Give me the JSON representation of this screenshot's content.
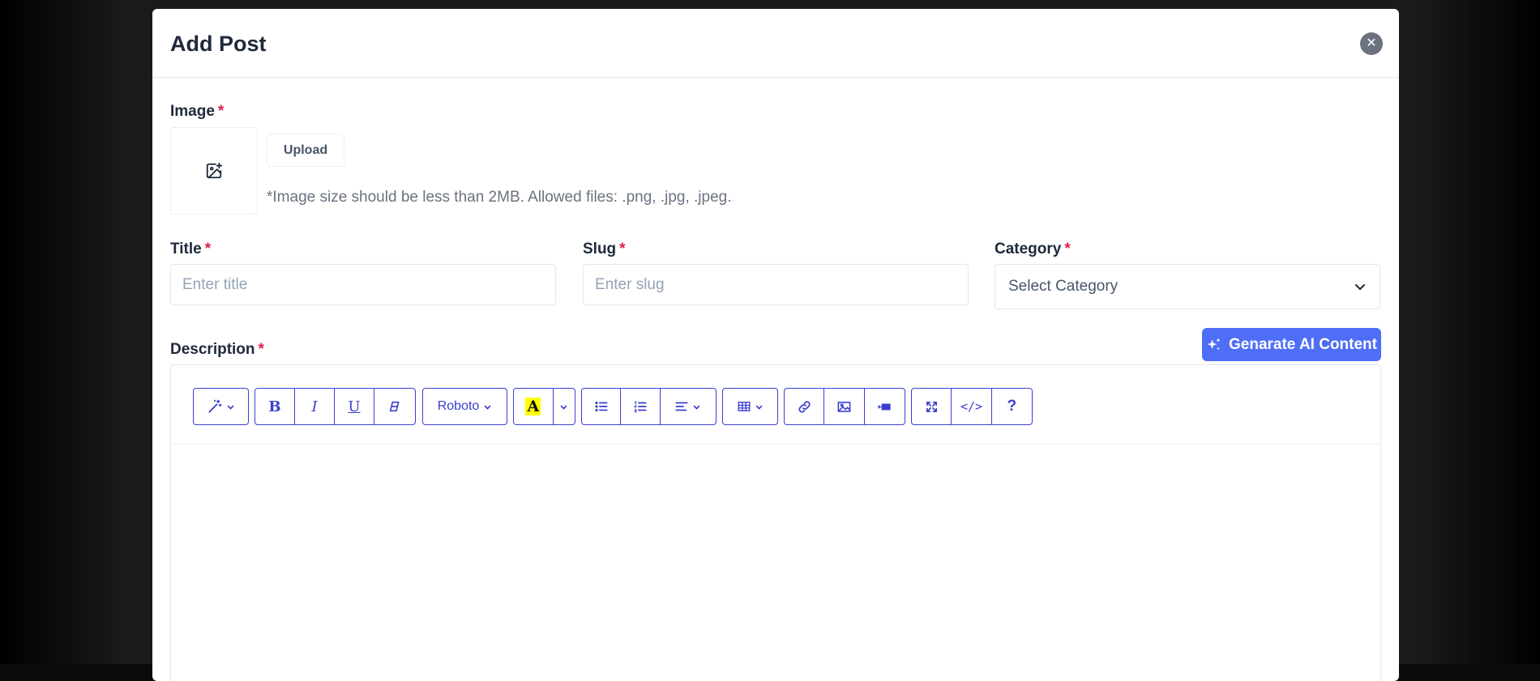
{
  "modal": {
    "title": "Add Post",
    "close_symbol": "✕"
  },
  "image_field": {
    "label": "Image",
    "required_mark": "*",
    "upload_label": "Upload",
    "hint": "*Image size should be less than 2MB. Allowed files: .png, .jpg, .jpeg."
  },
  "title_field": {
    "label": "Title",
    "required_mark": "*",
    "placeholder": "Enter title",
    "value": ""
  },
  "slug_field": {
    "label": "Slug",
    "required_mark": "*",
    "placeholder": "Enter slug",
    "value": ""
  },
  "category_field": {
    "label": "Category",
    "required_mark": "*",
    "selected": "Select Category"
  },
  "description_field": {
    "label": "Description",
    "required_mark": "*",
    "ai_button_label": "Genarate AI Content"
  },
  "toolbar": {
    "font_name": "Roboto",
    "bold": "B",
    "italic": "I",
    "underline": "U",
    "color_letter": "A",
    "codeview": "</>",
    "help": "?"
  },
  "colors": {
    "accent": "#4f6ef7",
    "toolbar": "#3b3fcf",
    "required": "#e11d48",
    "highlight": "#ffff00"
  }
}
